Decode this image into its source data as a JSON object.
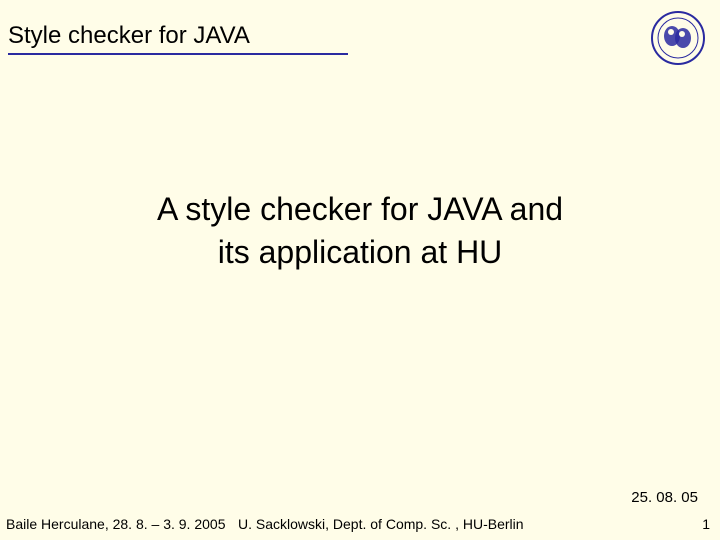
{
  "header": {
    "title": "Style checker for JAVA"
  },
  "logo": {
    "name": "humboldt-university-seal"
  },
  "main": {
    "title_line1": "A style checker for JAVA and",
    "title_line2": "its application at HU"
  },
  "date": "25. 08. 05",
  "footer": {
    "left": "Baile Herculane, 28. 8. – 3. 9. 2005",
    "center": "U. Sacklowski, Dept. of Comp. Sc. , HU-Berlin",
    "page": "1"
  }
}
